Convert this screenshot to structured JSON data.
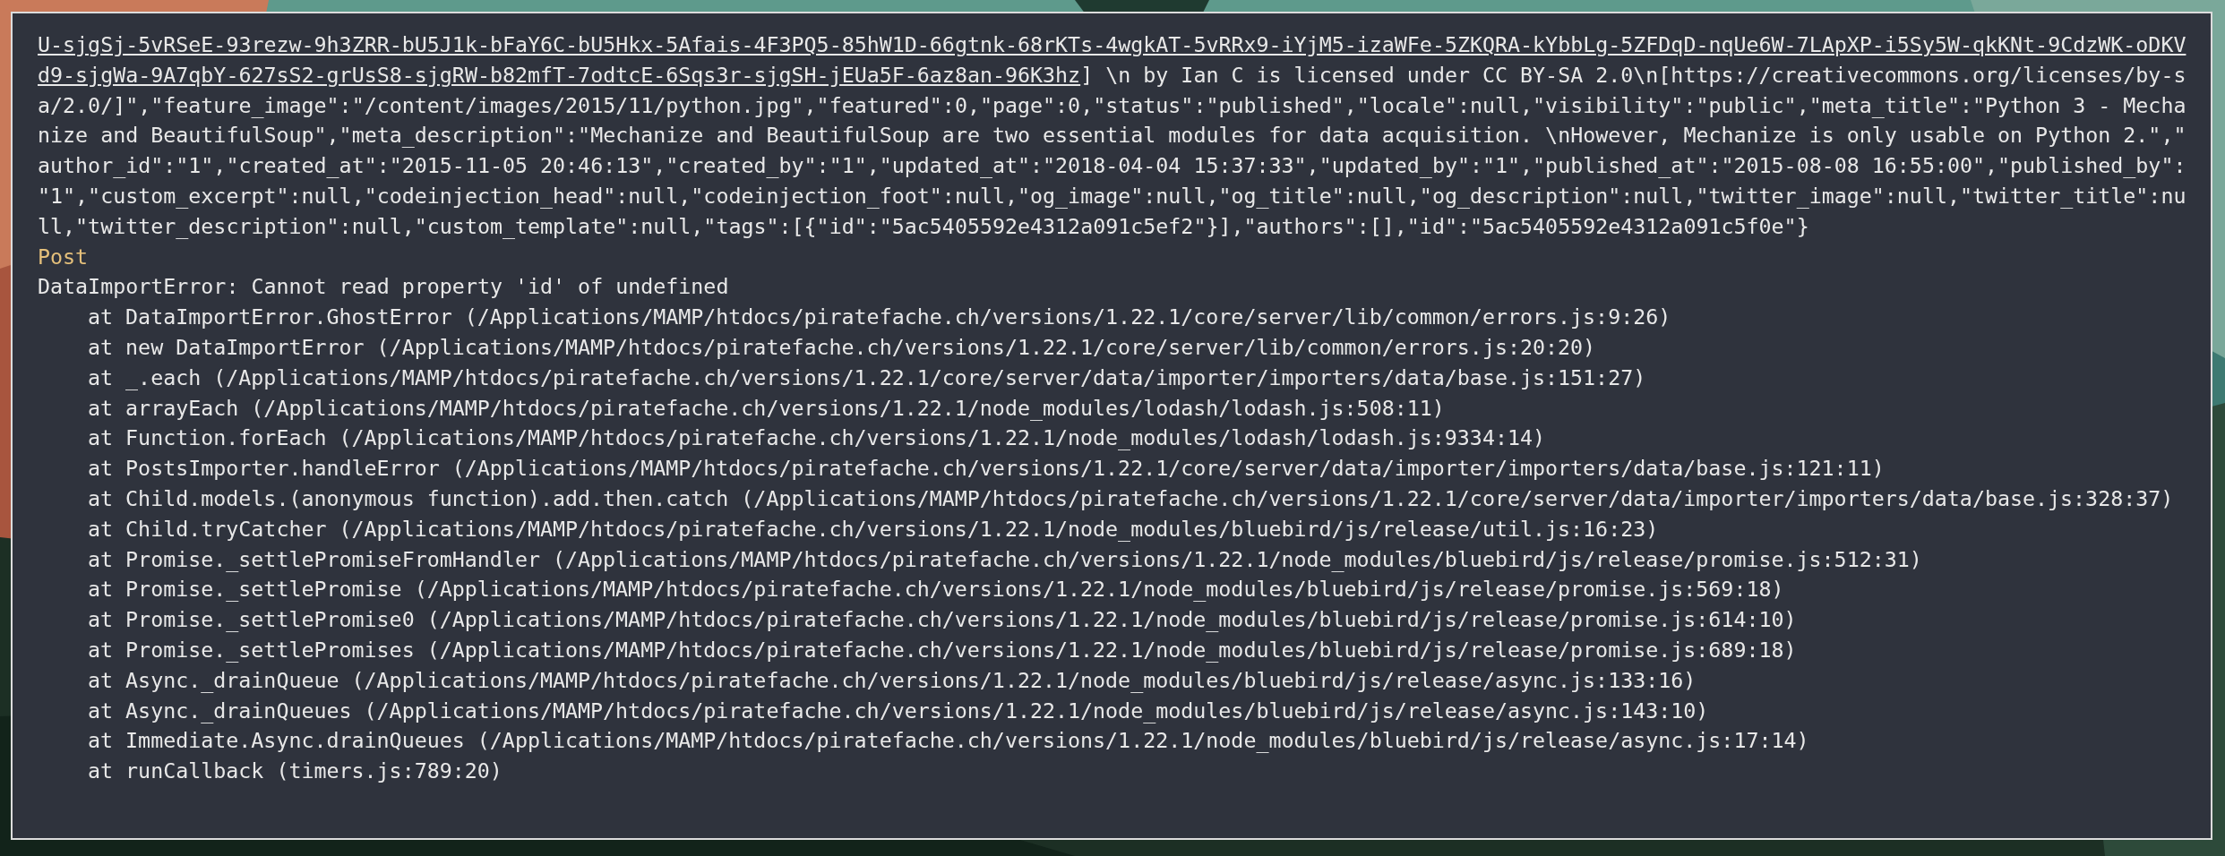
{
  "terminal": {
    "lines": [
      {
        "kind": "data",
        "link": "U-sjgSj-5vRSeE-93rezw-9h3ZRR-bU5J1k-bFaY6C-bU5Hkx-5Afais-4F3PQ5-85hW1D-66gtnk-68rKTs-4wgkAT-5vRRx9-iYjM5-izaWFe-5ZKQRA-kYbbLg-5ZFDqD-nqUe6W-7LApXP-i5Sy5W-qkKNt-9CdzWK-oDKV"
      },
      {
        "kind": "data",
        "link": "d9-sjgWa-9A7qbY-627sS2-grUsS8-sjgRW-b82mfT-7odtcE-6Sqs3r-sjgSH-jEUa5F-6az8an-96K3hz",
        "text": "] \\n by Ian C is licensed under CC BY-SA 2.0\\n[https://creativecommons.org/licenses/by-s"
      },
      {
        "kind": "data",
        "text": "a/2.0/]\",\"feature_image\":\"/content/images/2015/11/python.jpg\",\"featured\":0,\"page\":0,\"status\":\"published\",\"locale\":null,\"visibility\":\"public\",\"meta_title\":\"Python 3 - Mecha"
      },
      {
        "kind": "data",
        "text": "nize and BeautifulSoup\",\"meta_description\":\"Mechanize and BeautifulSoup are two essential modules for data acquisition. \\nHowever, Mechanize is only usable on Python 2.\",\""
      },
      {
        "kind": "data",
        "text": "author_id\":\"1\",\"created_at\":\"2015-11-05 20:46:13\",\"created_by\":\"1\",\"updated_at\":\"2018-04-04 15:37:33\",\"updated_by\":\"1\",\"published_at\":\"2015-08-08 16:55:00\",\"published_by\":"
      },
      {
        "kind": "data",
        "text": "\"1\",\"custom_excerpt\":null,\"codeinjection_head\":null,\"codeinjection_foot\":null,\"og_image\":null,\"og_title\":null,\"og_description\":null,\"twitter_image\":null,\"twitter_title\":nu"
      },
      {
        "kind": "data",
        "text": "ll,\"twitter_description\":null,\"custom_template\":null,\"tags\":[{\"id\":\"5ac5405592e4312a091c5ef2\"}],\"authors\":[],\"id\":\"5ac5405592e4312a091c5f0e\"}"
      },
      {
        "kind": "label",
        "text": "Post"
      },
      {
        "kind": "error",
        "text": "DataImportError: Cannot read property 'id' of undefined"
      },
      {
        "kind": "frame",
        "text": "at DataImportError.GhostError (/Applications/MAMP/htdocs/piratefache.ch/versions/1.22.1/core/server/lib/common/errors.js:9:26)"
      },
      {
        "kind": "frame",
        "text": "at new DataImportError (/Applications/MAMP/htdocs/piratefache.ch/versions/1.22.1/core/server/lib/common/errors.js:20:20)"
      },
      {
        "kind": "frame",
        "text": "at _.each (/Applications/MAMP/htdocs/piratefache.ch/versions/1.22.1/core/server/data/importer/importers/data/base.js:151:27)"
      },
      {
        "kind": "frame",
        "text": "at arrayEach (/Applications/MAMP/htdocs/piratefache.ch/versions/1.22.1/node_modules/lodash/lodash.js:508:11)"
      },
      {
        "kind": "frame",
        "text": "at Function.forEach (/Applications/MAMP/htdocs/piratefache.ch/versions/1.22.1/node_modules/lodash/lodash.js:9334:14)"
      },
      {
        "kind": "frame",
        "text": "at PostsImporter.handleError (/Applications/MAMP/htdocs/piratefache.ch/versions/1.22.1/core/server/data/importer/importers/data/base.js:121:11)"
      },
      {
        "kind": "frame",
        "text": "at Child.models.(anonymous function).add.then.catch (/Applications/MAMP/htdocs/piratefache.ch/versions/1.22.1/core/server/data/importer/importers/data/base.js:328:37)"
      },
      {
        "kind": "frame",
        "text": "at Child.tryCatcher (/Applications/MAMP/htdocs/piratefache.ch/versions/1.22.1/node_modules/bluebird/js/release/util.js:16:23)"
      },
      {
        "kind": "frame",
        "text": "at Promise._settlePromiseFromHandler (/Applications/MAMP/htdocs/piratefache.ch/versions/1.22.1/node_modules/bluebird/js/release/promise.js:512:31)"
      },
      {
        "kind": "frame",
        "text": "at Promise._settlePromise (/Applications/MAMP/htdocs/piratefache.ch/versions/1.22.1/node_modules/bluebird/js/release/promise.js:569:18)"
      },
      {
        "kind": "frame",
        "text": "at Promise._settlePromise0 (/Applications/MAMP/htdocs/piratefache.ch/versions/1.22.1/node_modules/bluebird/js/release/promise.js:614:10)"
      },
      {
        "kind": "frame",
        "text": "at Promise._settlePromises (/Applications/MAMP/htdocs/piratefache.ch/versions/1.22.1/node_modules/bluebird/js/release/promise.js:689:18)"
      },
      {
        "kind": "frame",
        "text": "at Async._drainQueue (/Applications/MAMP/htdocs/piratefache.ch/versions/1.22.1/node_modules/bluebird/js/release/async.js:133:16)"
      },
      {
        "kind": "frame",
        "text": "at Async._drainQueues (/Applications/MAMP/htdocs/piratefache.ch/versions/1.22.1/node_modules/bluebird/js/release/async.js:143:10)"
      },
      {
        "kind": "frame",
        "text": "at Immediate.Async.drainQueues (/Applications/MAMP/htdocs/piratefache.ch/versions/1.22.1/node_modules/bluebird/js/release/async.js:17:14)"
      },
      {
        "kind": "frame",
        "text": "at runCallback (timers.js:789:20)"
      }
    ]
  }
}
